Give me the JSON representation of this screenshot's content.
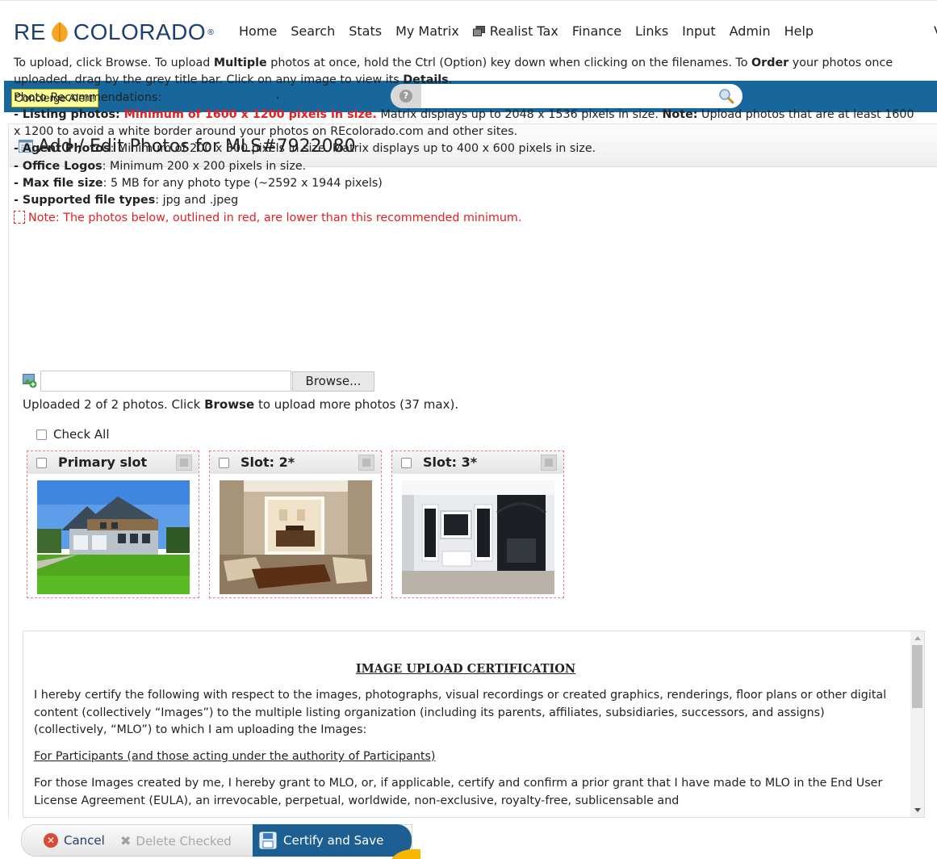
{
  "logo": {
    "left": "RE",
    "right": "COLORADO",
    "reg": "®"
  },
  "nav": {
    "items": [
      "Home",
      "Search",
      "Stats",
      "My Matrix",
      "Realist Tax",
      "Finance",
      "Links",
      "Input",
      "Admin",
      "Help"
    ],
    "clipped": "V"
  },
  "bluebar": {
    "concierge_label": "Concierge Alert!",
    "dot": ".",
    "search_placeholder": "",
    "help_symbol": "?"
  },
  "panel": {
    "title": "Add / Edit Photos for MLS#7922080"
  },
  "instructions": {
    "p1_a": "To upload, click Browse. To upload ",
    "p1_b": "Multiple",
    "p1_c": " photos at once, hold the Ctrl (Option) key down when clicking on the filenames. To ",
    "p1_d": "Order",
    "p1_e": " your photos once uploaded, drag by the grey title bar. Click on any image to view its ",
    "p1_f": "Details",
    "p1_g": ".",
    "recs": "Photo Recommendations:",
    "listing_label": "- Listing photos: ",
    "listing_red": "Minimum of 1600 x 1200 pixels in size.",
    "listing_text": " Matrix displays up to 2048 x 1536 pixels in size. ",
    "listing_note_label": "Note:",
    "listing_note": " Upload photos that are at least 1600 x 1200 to avoid a white border around your photos on REcolorado.com and other sites.",
    "agent_label": "- Agent Photos",
    "agent_text": ": Minimum of 200 x 300 pixels in size. Matrix displays up to 400 x 600 pixels in size.",
    "office_label": "- Office Logos",
    "office_text": ": Minimum 200 x 200 pixels in size.",
    "max_label": "- Max file size",
    "max_text": ": 5 MB for any photo type (~2592 x 1944 pixels)",
    "types_label": "- Supported file types",
    "types_text": ": jpg and .jpeg",
    "red_note": "Note: The photos below, outlined in red, are lower than this recommended minimum."
  },
  "upload": {
    "browse_label": "Browse...",
    "uploaded_a": "Uploaded 2 of 2 photos. Click ",
    "uploaded_b": "Browse",
    "uploaded_c": " to upload more photos (37 max)."
  },
  "check_all_label": "Check All",
  "slots": [
    {
      "title": "Primary slot",
      "photo": "house-exterior"
    },
    {
      "title": "Slot: 2*",
      "photo": "living-room"
    },
    {
      "title": "Slot: 3*",
      "photo": "fireplace-room"
    }
  ],
  "certification": {
    "title": "IMAGE UPLOAD CERTIFICATION",
    "p1": "I hereby certify the following with respect to the images, photographs, visual recordings or created graphics, renderings, floor plans or other digital content (collectively “Images”) to the multiple listing organization (including its parents, affiliates, subsidiaries, successors, and assigns) (collectively, “MLO”) to which I am uploading the Images:",
    "sub": "For Participants (and those acting under the authority of Participants)",
    "p2": "For those Images created by me, I hereby grant to MLO, or, if applicable, certify and confirm a prior grant that I have made to MLO in the End User License Agreement (EULA), an irrevocable, perpetual, worldwide, non-exclusive, royalty-free, sublicensable and"
  },
  "actions": {
    "cancel": "Cancel",
    "delete": "Delete Checked",
    "save": "Certify and Save"
  },
  "colors": {
    "brand_blue": "#17669c",
    "save_blue": "#1d5f93",
    "alert_red": "#e42020",
    "concierge_yellow": "#ffff9a"
  }
}
